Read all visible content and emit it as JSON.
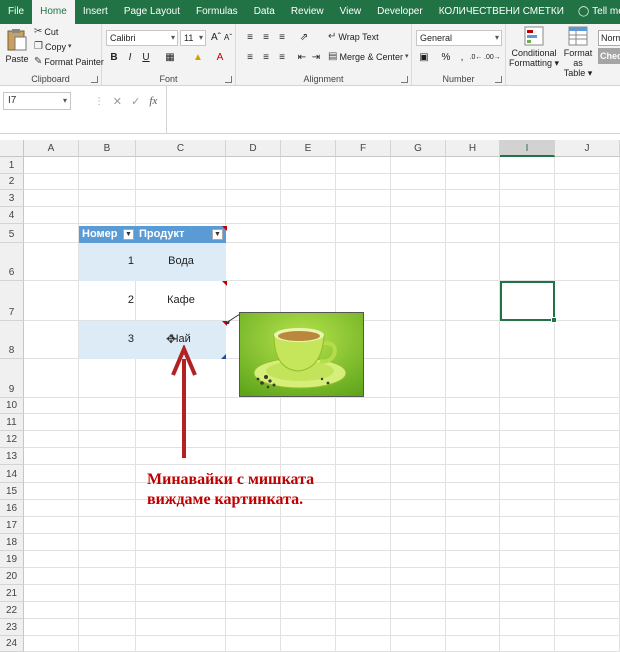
{
  "ribbon_tabs": [
    "File",
    "Home",
    "Insert",
    "Page Layout",
    "Formulas",
    "Data",
    "Review",
    "View",
    "Developer",
    "КОЛИЧЕСТВЕНИ СМЕТКИ",
    "Tell me what you want t"
  ],
  "clipboard": {
    "paste": "Paste",
    "cut": "Cut",
    "copy": "Copy",
    "format_painter": "Format Painter",
    "label": "Clipboard"
  },
  "font": {
    "name": "Calibri",
    "size": "11",
    "bold": "B",
    "italic": "I",
    "underline": "U",
    "label": "Font"
  },
  "alignment": {
    "wrap_text": "Wrap Text",
    "merge_center": "Merge & Center",
    "label": "Alignment"
  },
  "number": {
    "format": "General",
    "label": "Number"
  },
  "styles": {
    "conditional_formatting_1": "Conditional",
    "conditional_formatting_2": "Formatting",
    "format_as_table_1": "Format as",
    "format_as_table_2": "Table",
    "normal": "Norm",
    "check": "Chec"
  },
  "name_box": "I7",
  "formula_bar": {
    "fx": "fx"
  },
  "columns": [
    "A",
    "B",
    "C",
    "D",
    "E",
    "F",
    "G",
    "H",
    "I",
    "J"
  ],
  "selected_column": "I",
  "rows": [
    "1",
    "2",
    "3",
    "4",
    "5",
    "6",
    "7",
    "8",
    "9",
    "10",
    "11",
    "12",
    "13",
    "14",
    "15",
    "16",
    "17",
    "18",
    "19",
    "20",
    "21",
    "22",
    "23",
    "24"
  ],
  "table": {
    "headers": [
      "Номер",
      "Продукт"
    ],
    "rows": [
      {
        "num": "1",
        "product": "Вода"
      },
      {
        "num": "2",
        "product": "Кафе"
      },
      {
        "num": "3",
        "product": "Чай"
      }
    ]
  },
  "annotation": {
    "line1": "Минавайки с мишката",
    "line2": "виждаме картинката."
  },
  "colors": {
    "excel_green": "#217346",
    "table_header": "#5b9bd5",
    "band": "#ddebf7",
    "annotation": "#c00000"
  }
}
